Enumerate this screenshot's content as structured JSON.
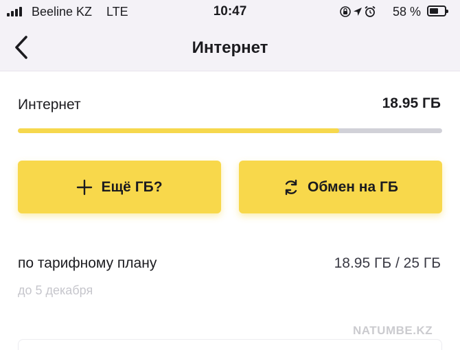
{
  "status_bar": {
    "carrier": "Beeline KZ",
    "network": "LTE",
    "time": "10:47",
    "battery_percent_label": "58 %",
    "battery_level": 0.58,
    "icons": [
      "signal-icon",
      "orientation-lock-icon",
      "location-icon",
      "alarm-icon",
      "battery-icon"
    ]
  },
  "nav": {
    "title": "Интернет",
    "back_icon": "chevron-left-icon"
  },
  "internet": {
    "label": "Интернет",
    "remaining": "18.95 ГБ",
    "progress": 0.758,
    "progress_color": "#f6d84d"
  },
  "actions": {
    "more_label": "Ещё ГБ?",
    "more_icon": "plus-icon",
    "exchange_label": "Обмен на ГБ",
    "exchange_icon": "refresh-icon",
    "button_color": "#f8d84b"
  },
  "plan": {
    "label": "по тарифному плану",
    "value": "18.95 ГБ / 25 ГБ",
    "expiry": "до 5 декабря"
  },
  "watermark": "NATUMBE.KZ"
}
